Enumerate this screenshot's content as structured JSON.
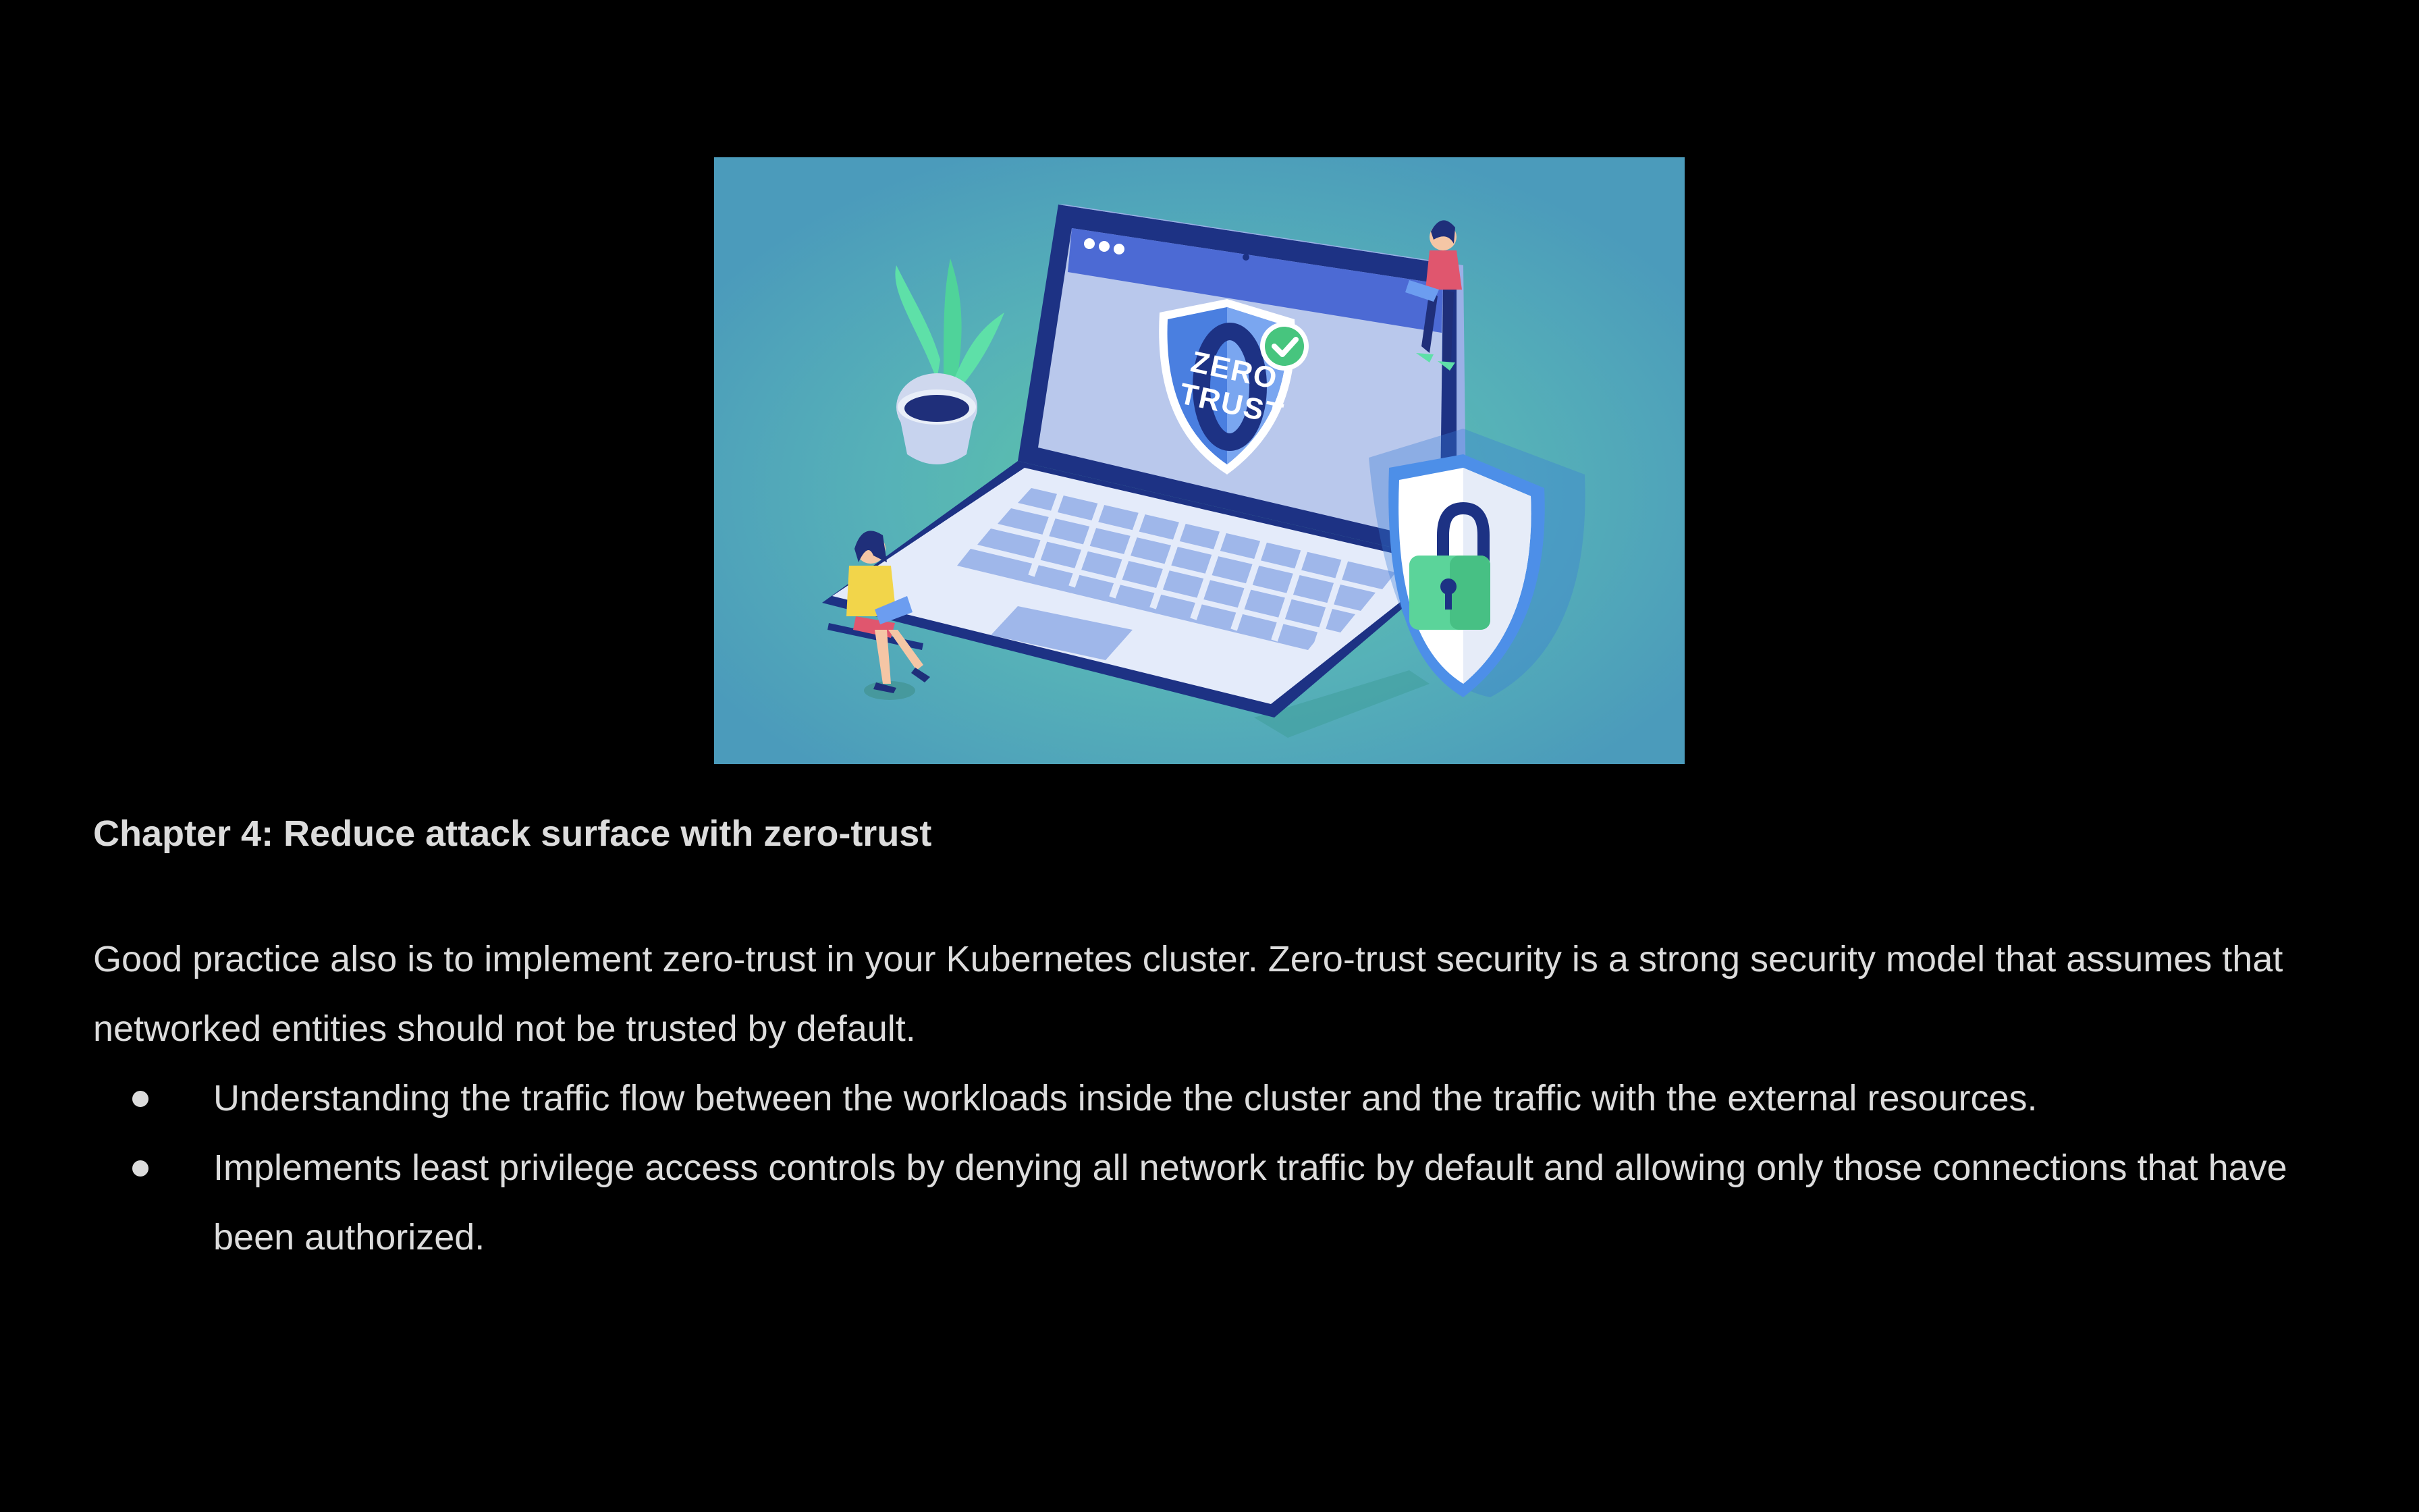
{
  "hero": {
    "shield_text_line1": "ZERO",
    "shield_text_line2": "TRUST"
  },
  "heading": "Chapter 4: Reduce attack surface with zero-trust",
  "paragraph": "Good practice also is to implement zero-trust in your Kubernetes cluster. Zero-trust security is a strong security model that assumes that networked entities should not be trusted by default.",
  "bullets": [
    "Understanding the traffic flow between the workloads inside the cluster and the traffic with the external resources.",
    "Implements least privilege access controls by denying all network traffic by default and allowing only those connections that have been authorized."
  ]
}
